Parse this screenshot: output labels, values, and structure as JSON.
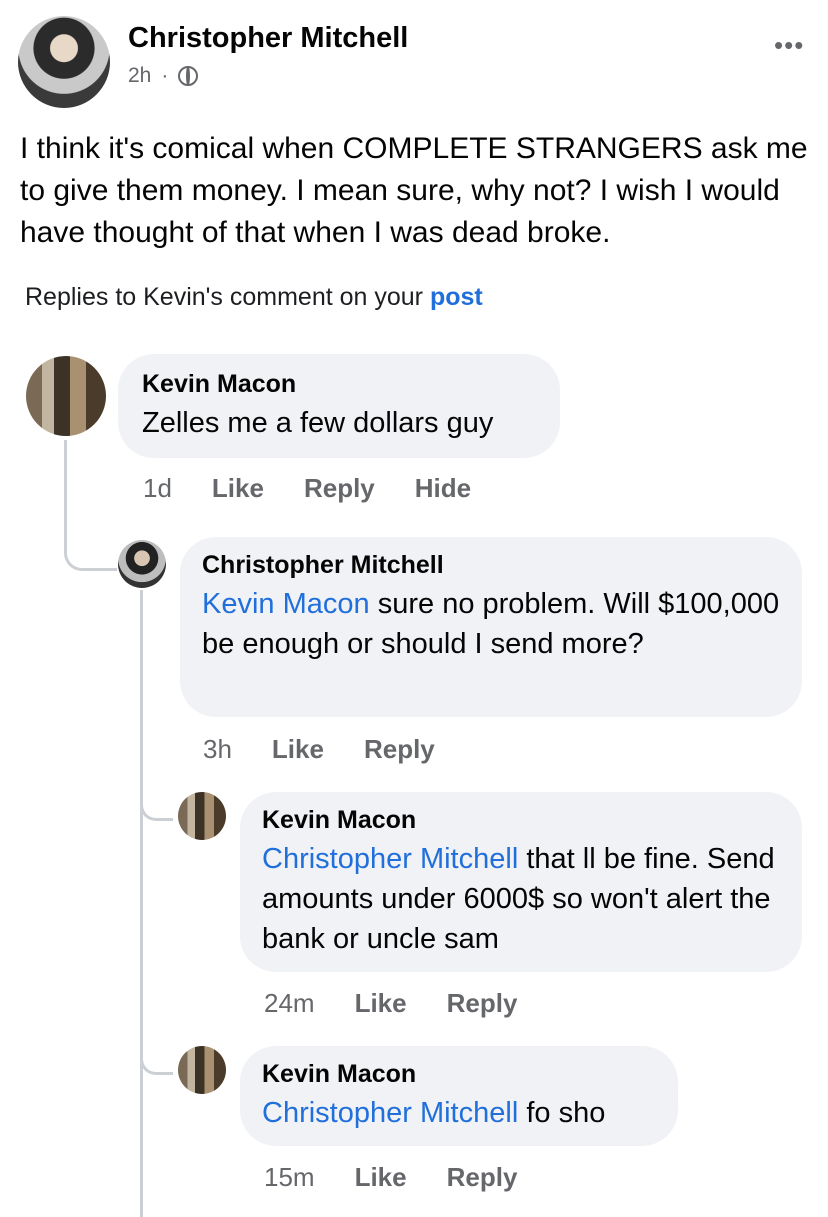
{
  "post": {
    "author": "Christopher Mitchell",
    "time": "2h",
    "dot": "·",
    "privacy_icon": "globe-icon",
    "more_icon": "more-icon",
    "more_glyph": "•••",
    "text": "I think it's comical when COMPLETE STRANGERS ask me to give them money. I mean sure, why not? I wish I would have thought of that when I was dead broke."
  },
  "replies_header": {
    "prefix": "Replies to Kevin's comment on your",
    "link": "post"
  },
  "comments": [
    {
      "author": "Kevin Macon",
      "mention": "",
      "text": "Zelles me a few dollars guy",
      "time": "1d",
      "like": "Like",
      "reply": "Reply",
      "hide": "Hide"
    },
    {
      "author": "Christopher Mitchell",
      "mention": "Kevin Macon",
      "text": "sure no problem. Will $100,000 be enough or should I send more?",
      "time": "3h",
      "like": "Like",
      "reply": "Reply"
    },
    {
      "author": "Kevin Macon",
      "mention": "Christopher Mitchell",
      "text": "that ll be  fine. Send amounts under 6000$ so won't alert the bank or uncle sam",
      "time": "24m",
      "like": "Like",
      "reply": "Reply"
    },
    {
      "author": "Kevin Macon",
      "mention": "Christopher Mitchell",
      "text": "fo sho",
      "time": "15m",
      "like": "Like",
      "reply": "Reply"
    }
  ]
}
